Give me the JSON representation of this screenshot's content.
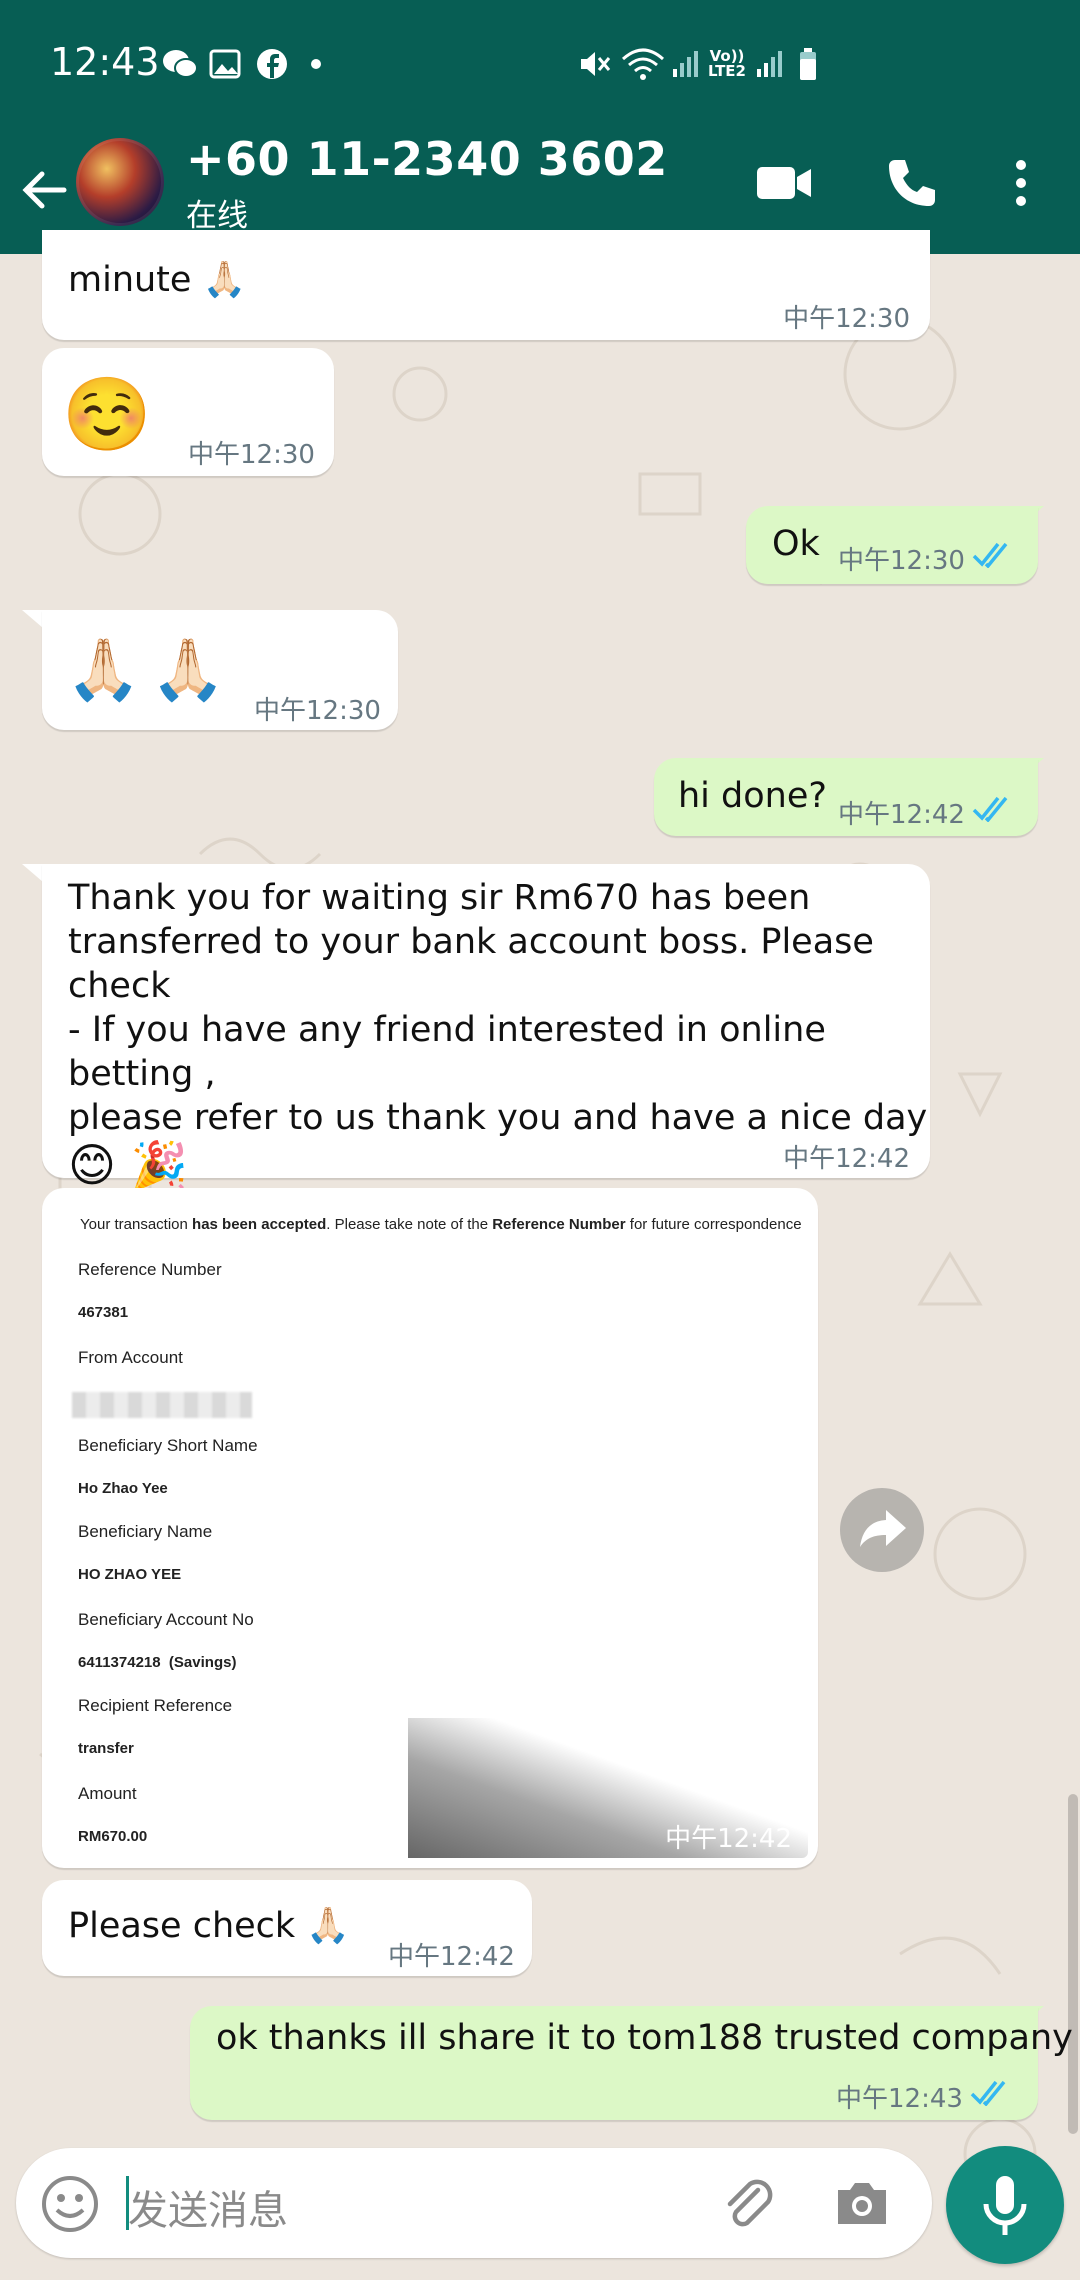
{
  "status_bar": {
    "time": "12:43",
    "carrier_lte": "Vo))\nLTE2",
    "icons": [
      "wechat-icon",
      "gallery-icon",
      "facebook-icon",
      "dot-icon",
      "mute-icon",
      "wifi-icon",
      "signal-icon",
      "lte2-icon",
      "signal-icon",
      "battery-icon"
    ]
  },
  "header": {
    "contact_name": "+60 11-2340 3602",
    "contact_status": "在线",
    "icons": [
      "back-arrow-icon",
      "video-call-icon",
      "voice-call-icon",
      "more-options-icon"
    ]
  },
  "messages": [
    {
      "id": "m1",
      "direction": "in",
      "text": "minute 🙏🏻",
      "time": "中午12:30"
    },
    {
      "id": "m2",
      "direction": "in",
      "text": "☺️",
      "time": "中午12:30"
    },
    {
      "id": "m3",
      "direction": "out",
      "text": "Ok",
      "time": "中午12:30",
      "status": "read"
    },
    {
      "id": "m4",
      "direction": "in",
      "text": "🙏🏻🙏🏻",
      "time": "中午12:30"
    },
    {
      "id": "m5",
      "direction": "out",
      "text": "hi done?",
      "time": "中午12:42",
      "status": "read"
    },
    {
      "id": "m6",
      "direction": "in",
      "lines": [
        "Thank you for waiting sir Rm670 has been",
        "transferred to your bank account boss. Please",
        "check",
        "- If you have any friend interested in online betting ,",
        "please refer to us thank you and have a nice day",
        "😊 🎉"
      ],
      "time": "中午12:42"
    },
    {
      "id": "m7",
      "direction": "in",
      "type": "image",
      "time": "中午12:42"
    },
    {
      "id": "m8",
      "direction": "in",
      "text": "Please check 🙏🏻",
      "time": "中午12:42"
    },
    {
      "id": "m9",
      "direction": "out",
      "text": "ok thanks ill share it to tom188 trusted company",
      "time": "中午12:43",
      "status": "read"
    }
  ],
  "receipt": {
    "header_part1": "Your transaction ",
    "header_bold1": "has been accepted",
    "header_part2": ". Please take note of the ",
    "header_bold2": "Reference Number",
    "header_part3": " for future correspondence",
    "reference_number_label": "Reference Number",
    "reference_number": "467381",
    "from_account_label": "From Account",
    "beneficiary_short_name_label": "Beneficiary Short Name",
    "beneficiary_short_name": "Ho Zhao Yee",
    "beneficiary_name_label": "Beneficiary Name",
    "beneficiary_name": "HO ZHAO YEE",
    "beneficiary_account_label": "Beneficiary Account No",
    "beneficiary_account": "6411374218  (Savings)",
    "recipient_reference_label": "Recipient Reference",
    "recipient_reference": "transfer",
    "amount_label": "Amount",
    "amount": "RM670.00"
  },
  "composer": {
    "placeholder": "发送消息"
  },
  "colors": {
    "header": "#075e54",
    "outgoing_bubble": "#dcf8c6",
    "incoming_bubble": "#ffffff",
    "read_ticks": "#34b7f1",
    "mic_button": "#128c7e"
  }
}
